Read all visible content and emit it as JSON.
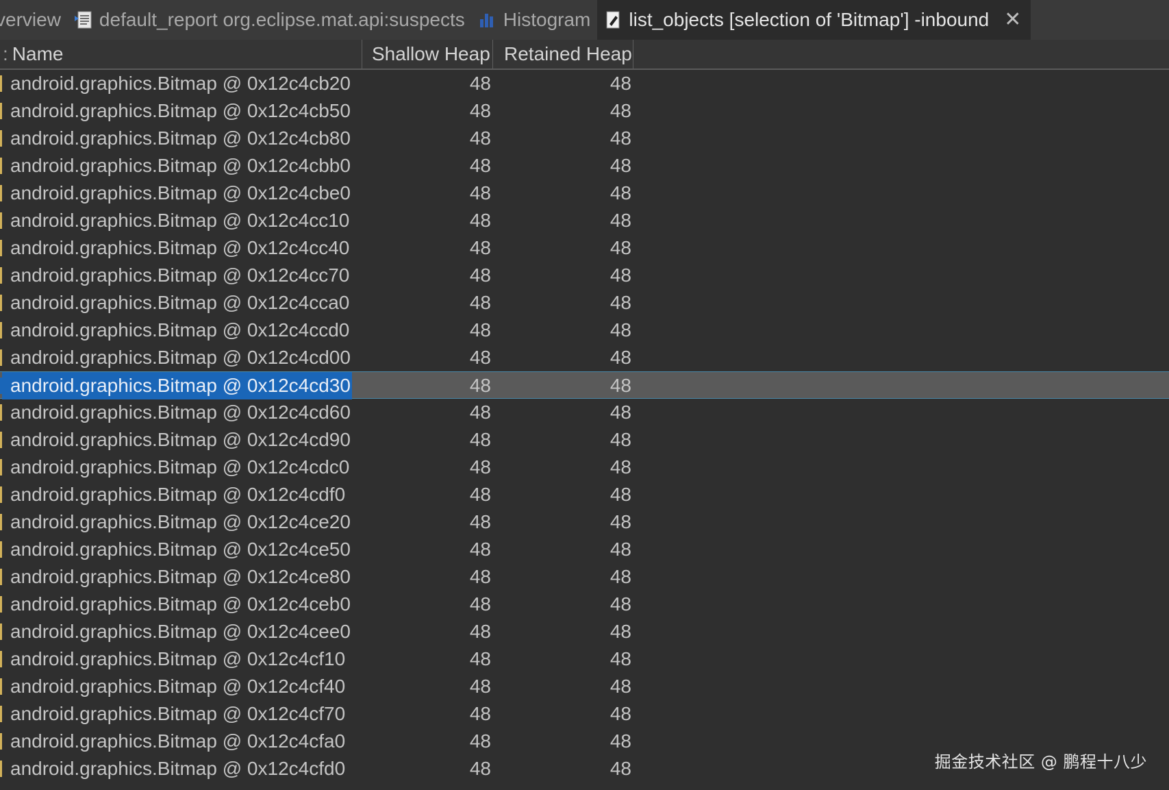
{
  "tabs": [
    {
      "label": "verview",
      "icon": "overview-icon",
      "active": false
    },
    {
      "label": "default_report org.eclipse.mat.api:suspects",
      "icon": "report-icon",
      "active": false
    },
    {
      "label": "Histogram",
      "icon": "histogram-icon",
      "active": false
    },
    {
      "label": "list_objects [selection of 'Bitmap'] -inbound",
      "icon": "query-icon",
      "active": true,
      "close_glyph": "✕"
    }
  ],
  "table": {
    "columns": {
      "lead": ":",
      "name": "Name",
      "shallow": "Shallow Heap",
      "retained": "Retained Heap"
    },
    "selected_index": 11,
    "rows": [
      {
        "name": "android.graphics.Bitmap @ 0x12c4cb20",
        "shallow": "48",
        "retained": "48"
      },
      {
        "name": "android.graphics.Bitmap @ 0x12c4cb50",
        "shallow": "48",
        "retained": "48"
      },
      {
        "name": "android.graphics.Bitmap @ 0x12c4cb80",
        "shallow": "48",
        "retained": "48"
      },
      {
        "name": "android.graphics.Bitmap @ 0x12c4cbb0",
        "shallow": "48",
        "retained": "48"
      },
      {
        "name": "android.graphics.Bitmap @ 0x12c4cbe0",
        "shallow": "48",
        "retained": "48"
      },
      {
        "name": "android.graphics.Bitmap @ 0x12c4cc10",
        "shallow": "48",
        "retained": "48"
      },
      {
        "name": "android.graphics.Bitmap @ 0x12c4cc40",
        "shallow": "48",
        "retained": "48"
      },
      {
        "name": "android.graphics.Bitmap @ 0x12c4cc70",
        "shallow": "48",
        "retained": "48"
      },
      {
        "name": "android.graphics.Bitmap @ 0x12c4cca0",
        "shallow": "48",
        "retained": "48"
      },
      {
        "name": "android.graphics.Bitmap @ 0x12c4ccd0",
        "shallow": "48",
        "retained": "48"
      },
      {
        "name": "android.graphics.Bitmap @ 0x12c4cd00",
        "shallow": "48",
        "retained": "48"
      },
      {
        "name": "android.graphics.Bitmap @ 0x12c4cd30",
        "shallow": "48",
        "retained": "48"
      },
      {
        "name": "android.graphics.Bitmap @ 0x12c4cd60",
        "shallow": "48",
        "retained": "48"
      },
      {
        "name": "android.graphics.Bitmap @ 0x12c4cd90",
        "shallow": "48",
        "retained": "48"
      },
      {
        "name": "android.graphics.Bitmap @ 0x12c4cdc0",
        "shallow": "48",
        "retained": "48"
      },
      {
        "name": "android.graphics.Bitmap @ 0x12c4cdf0",
        "shallow": "48",
        "retained": "48"
      },
      {
        "name": "android.graphics.Bitmap @ 0x12c4ce20",
        "shallow": "48",
        "retained": "48"
      },
      {
        "name": "android.graphics.Bitmap @ 0x12c4ce50",
        "shallow": "48",
        "retained": "48"
      },
      {
        "name": "android.graphics.Bitmap @ 0x12c4ce80",
        "shallow": "48",
        "retained": "48"
      },
      {
        "name": "android.graphics.Bitmap @ 0x12c4ceb0",
        "shallow": "48",
        "retained": "48"
      },
      {
        "name": "android.graphics.Bitmap @ 0x12c4cee0",
        "shallow": "48",
        "retained": "48"
      },
      {
        "name": "android.graphics.Bitmap @ 0x12c4cf10",
        "shallow": "48",
        "retained": "48"
      },
      {
        "name": "android.graphics.Bitmap @ 0x12c4cf40",
        "shallow": "48",
        "retained": "48"
      },
      {
        "name": "android.graphics.Bitmap @ 0x12c4cf70",
        "shallow": "48",
        "retained": "48"
      },
      {
        "name": "android.graphics.Bitmap @ 0x12c4cfa0",
        "shallow": "48",
        "retained": "48"
      },
      {
        "name": "android.graphics.Bitmap @ 0x12c4cfd0",
        "shallow": "48",
        "retained": "48"
      }
    ]
  },
  "watermark": "掘金技术社区 @ 鹏程十八少",
  "colors": {
    "background": "#2f2f2f",
    "tabbar": "#3a3a3a",
    "selection": "#1a66b8",
    "selected_row": "#5a5a5a",
    "marker": "#d2b25a"
  }
}
